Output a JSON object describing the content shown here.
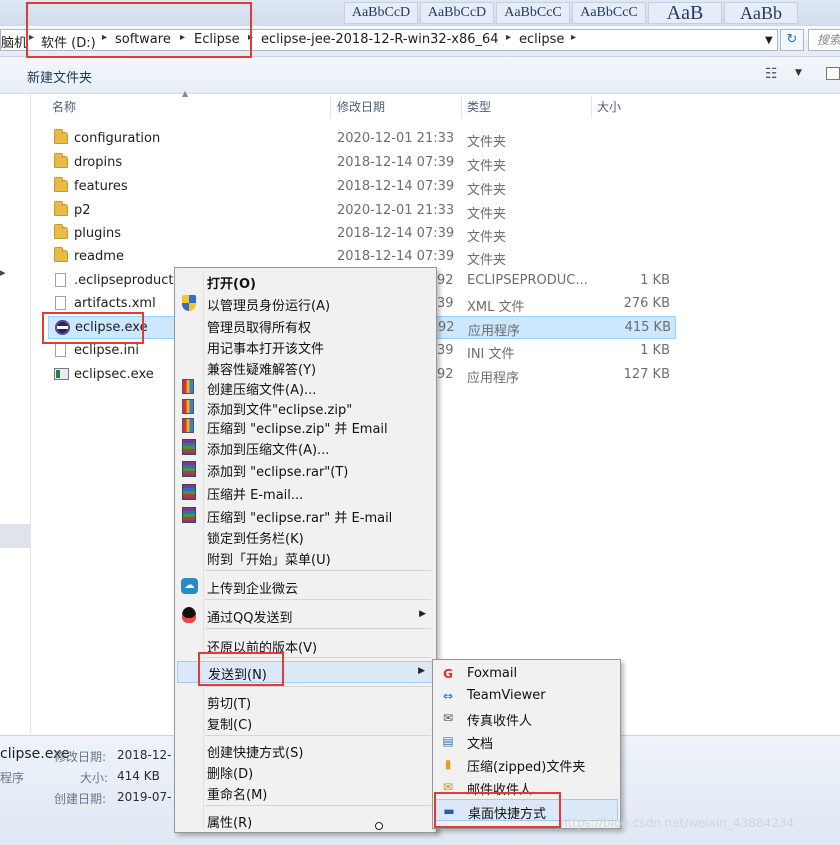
{
  "top_strip": {
    "styles": [
      "AaBbCcD",
      "AaBbCcD",
      "AaBbCcC",
      "AaB",
      "AaBb"
    ]
  },
  "address_bar": {
    "crumbs": [
      "脑机",
      "软件 (D:)",
      "software",
      "Eclipse",
      "eclipse-jee-2018-12-R-win32-x86_64",
      "eclipse"
    ],
    "search_placeholder": "搜索"
  },
  "toolbar": {
    "new_folder": "新建文件夹"
  },
  "columns": {
    "name": "名称",
    "date": "修改日期",
    "type": "类型",
    "size": "大小"
  },
  "files": [
    {
      "name": "configuration",
      "date": "2020-12-01 21:33",
      "type": "文件夹",
      "size": "",
      "icon": "folder-icon"
    },
    {
      "name": "dropins",
      "date": "2018-12-14 07:39",
      "type": "文件夹",
      "size": "",
      "icon": "folder-icon"
    },
    {
      "name": "features",
      "date": "2018-12-14 07:39",
      "type": "文件夹",
      "size": "",
      "icon": "folder-icon"
    },
    {
      "name": "p2",
      "date": "2020-12-01 21:33",
      "type": "文件夹",
      "size": "",
      "icon": "folder-icon"
    },
    {
      "name": "plugins",
      "date": "2018-12-14 07:39",
      "type": "文件夹",
      "size": "",
      "icon": "folder-icon"
    },
    {
      "name": "readme",
      "date": "2018-12-14 07:39",
      "type": "文件夹",
      "size": "",
      "icon": "folder-icon"
    },
    {
      "name": ".eclipseproduct",
      "date": "92",
      "type": "ECLIPSEPRODUC...",
      "size": "1 KB",
      "icon": "document-icon"
    },
    {
      "name": "artifacts.xml",
      "date": "39",
      "type": "XML 文件",
      "size": "276 KB",
      "icon": "xml-document-icon"
    },
    {
      "name": "eclipse.exe",
      "date": "92",
      "type": "应用程序",
      "size": "415 KB",
      "icon": "eclipse-icon"
    },
    {
      "name": "eclipse.ini",
      "date": "39",
      "type": "INI 文件",
      "size": "1 KB",
      "icon": "ini-document-icon"
    },
    {
      "name": "eclipsec.exe",
      "date": "92",
      "type": "应用程序",
      "size": "127 KB",
      "icon": "executable-icon"
    }
  ],
  "details": {
    "name": "clipse.exe",
    "modified_label": "修改日期:",
    "modified_value": "2018-12-",
    "type_value": "程序",
    "size_label": "大小:",
    "size_value": "414 KB",
    "created_label": "创建日期:",
    "created_value": "2019-07-"
  },
  "context_menu": {
    "items": [
      {
        "label": "打开(O)"
      },
      {
        "label": "以管理员身份运行(A)"
      },
      {
        "label": "管理员取得所有权"
      },
      {
        "label": "用记事本打开该文件"
      },
      {
        "label": "兼容性疑难解答(Y)"
      },
      {
        "label": "创建压缩文件(A)..."
      },
      {
        "label": "添加到文件\"eclipse.zip\""
      },
      {
        "label": "压缩到 \"eclipse.zip\" 并 Email"
      },
      {
        "label": "添加到压缩文件(A)..."
      },
      {
        "label": "添加到 \"eclipse.rar\"(T)"
      },
      {
        "label": "压缩并 E-mail..."
      },
      {
        "label": "压缩到 \"eclipse.rar\" 并 E-mail"
      },
      {
        "label": "锁定到任务栏(K)"
      },
      {
        "label": "附到「开始」菜单(U)"
      },
      {
        "label": "上传到企业微云"
      },
      {
        "label": "通过QQ发送到"
      },
      {
        "label": "还原以前的版本(V)"
      },
      {
        "label": "发送到(N)"
      },
      {
        "label": "剪切(T)"
      },
      {
        "label": "复制(C)"
      },
      {
        "label": "创建快捷方式(S)"
      },
      {
        "label": "删除(D)"
      },
      {
        "label": "重命名(M)"
      },
      {
        "label": "属性(R)"
      }
    ]
  },
  "send_to_menu": {
    "items": [
      {
        "label": "Foxmail"
      },
      {
        "label": "TeamViewer"
      },
      {
        "label": "传真收件人"
      },
      {
        "label": "文档"
      },
      {
        "label": "压缩(zipped)文件夹"
      },
      {
        "label": "邮件收件人"
      },
      {
        "label": "桌面快捷方式"
      }
    ]
  },
  "watermark": "https://blog.csdn.net/weixin_43884234",
  "colors": {
    "selection": "#cce8ff",
    "menu_hover": "#dbe8f8",
    "annotation_red": "#e53935"
  }
}
